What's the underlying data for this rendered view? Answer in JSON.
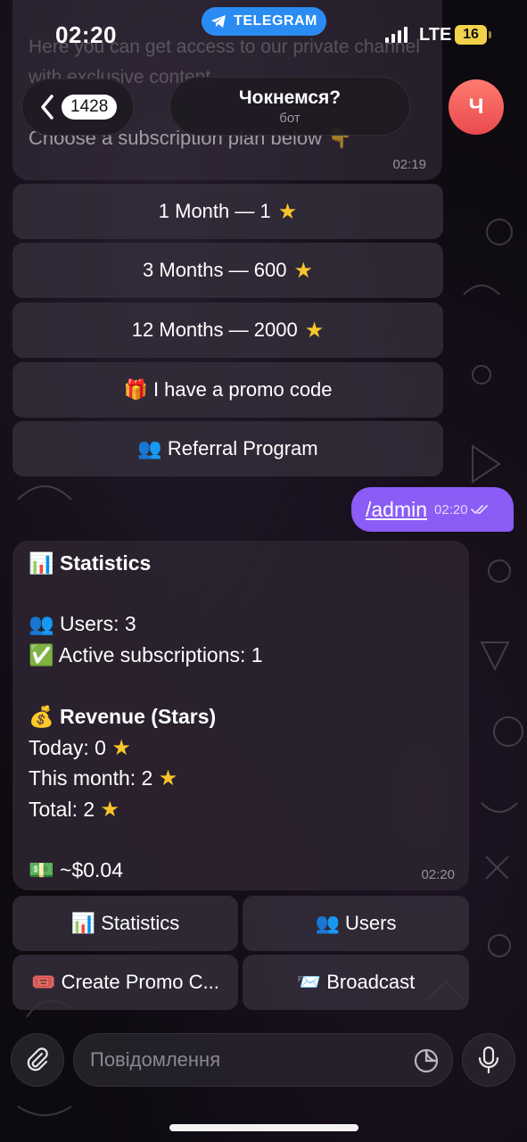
{
  "status_bar": {
    "time": "02:20",
    "app_pill": "TELEGRAM",
    "network": "LTE",
    "battery": "16"
  },
  "header": {
    "back_count": "1428",
    "chat_name": "Чокнемся?",
    "chat_subtitle": "бот",
    "avatar_letter": "Ч"
  },
  "prev_message": {
    "faded_text": "Here you can get access to our private channel with exclusive content.",
    "text": "Choose a subscription plan below 👇",
    "time": "02:19"
  },
  "plan_buttons": [
    {
      "label": "1 Month — 1",
      "icon": "star"
    },
    {
      "label": "3 Months — 600",
      "icon": "star"
    },
    {
      "label": "12 Months — 2000",
      "icon": "star"
    },
    {
      "label": "🎁 I have a promo code"
    },
    {
      "label": "👥 Referral Program"
    }
  ],
  "outgoing": {
    "text": "/admin",
    "time": "02:20"
  },
  "stats": {
    "heading": "📊 Statistics",
    "users": "👥 Users: 3",
    "active": "✅ Active subscriptions: 1",
    "revenue_heading": "💰 Revenue (Stars)",
    "today": "Today: 0",
    "month": "This month: 2",
    "total": "Total: 2",
    "usd": "💵 ~$0.04",
    "time": "02:20"
  },
  "admin_buttons": [
    {
      "label": "📊 Statistics"
    },
    {
      "label": "👥 Users"
    },
    {
      "label": "🎟️ Create Promo C..."
    },
    {
      "label": "📨 Broadcast"
    }
  ],
  "composer": {
    "placeholder": "Повідомлення"
  },
  "colors": {
    "accent": "#8b5cf6",
    "telegram_blue": "#2a8cf2",
    "star": "#f7c52b",
    "avatar": "#e94a4f"
  }
}
